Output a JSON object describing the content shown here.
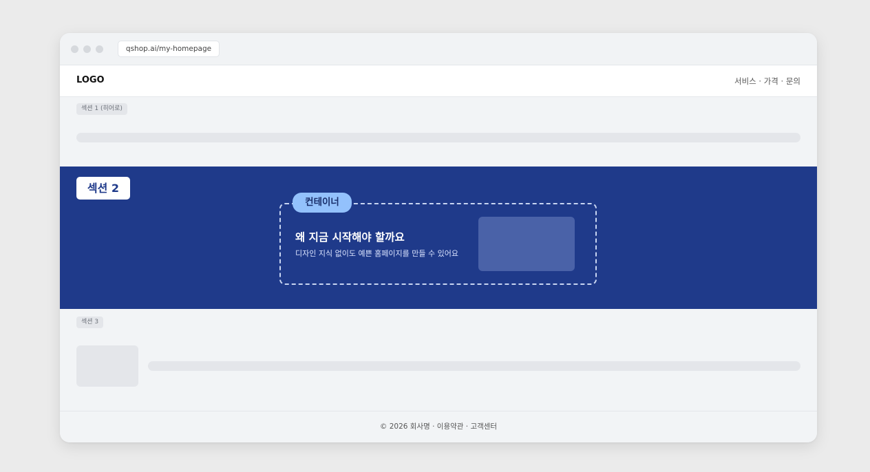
{
  "browser": {
    "url": "qshop.ai/my-homepage"
  },
  "navbar": {
    "logo": "LOGO",
    "links": "서비스 · 가격 · 문의"
  },
  "section1": {
    "label": "섹션 1 (히어로)"
  },
  "section2": {
    "label": "섹션 2",
    "container_label": "컨테이너",
    "headline": "왜 지금 시작해야 할까요",
    "subtext": "디자인 지식 없이도 예쁜 홈페이지를 만들 수 있어요"
  },
  "section3": {
    "label": "섹션 3"
  },
  "footer": {
    "text": "© 2026 회사명 · 이용약관 · 고객센터"
  },
  "colors": {
    "section2_bg": "#1f3a8a",
    "container_tag_bg": "#93c1fc",
    "page_bg": "#ebebeb"
  }
}
